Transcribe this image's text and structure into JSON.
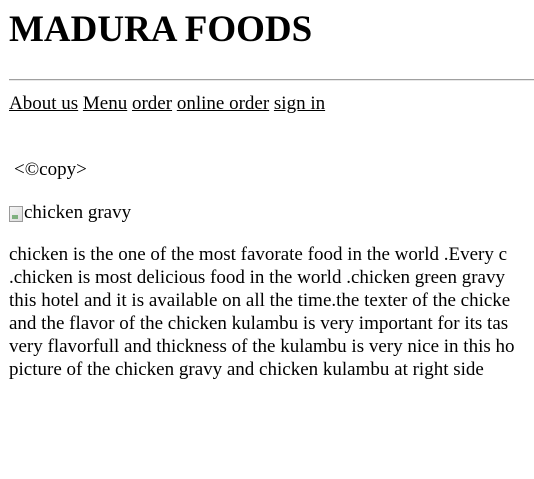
{
  "header": {
    "title": "MADURA FOODS"
  },
  "nav": {
    "items": [
      {
        "label": "About us"
      },
      {
        "label": "Menu"
      },
      {
        "label": "order"
      },
      {
        "label": "online order"
      },
      {
        "label": "sign in"
      }
    ]
  },
  "copy_line": "<©copy>",
  "image": {
    "alt": "chicken gravy"
  },
  "article": {
    "lines": [
      "chicken is the one of the most favorate food in the world .Every c",
      ".chicken is most delicious food in the world .chicken green gravy",
      "this hotel and it is available on all the time.the texter of the chicke",
      "and the flavor of the chicken kulambu is very important for its tas",
      "very flavorfull and thickness of the kulambu is very nice in this ho",
      "picture of the chicken gravy and chicken kulambu at right side"
    ]
  }
}
